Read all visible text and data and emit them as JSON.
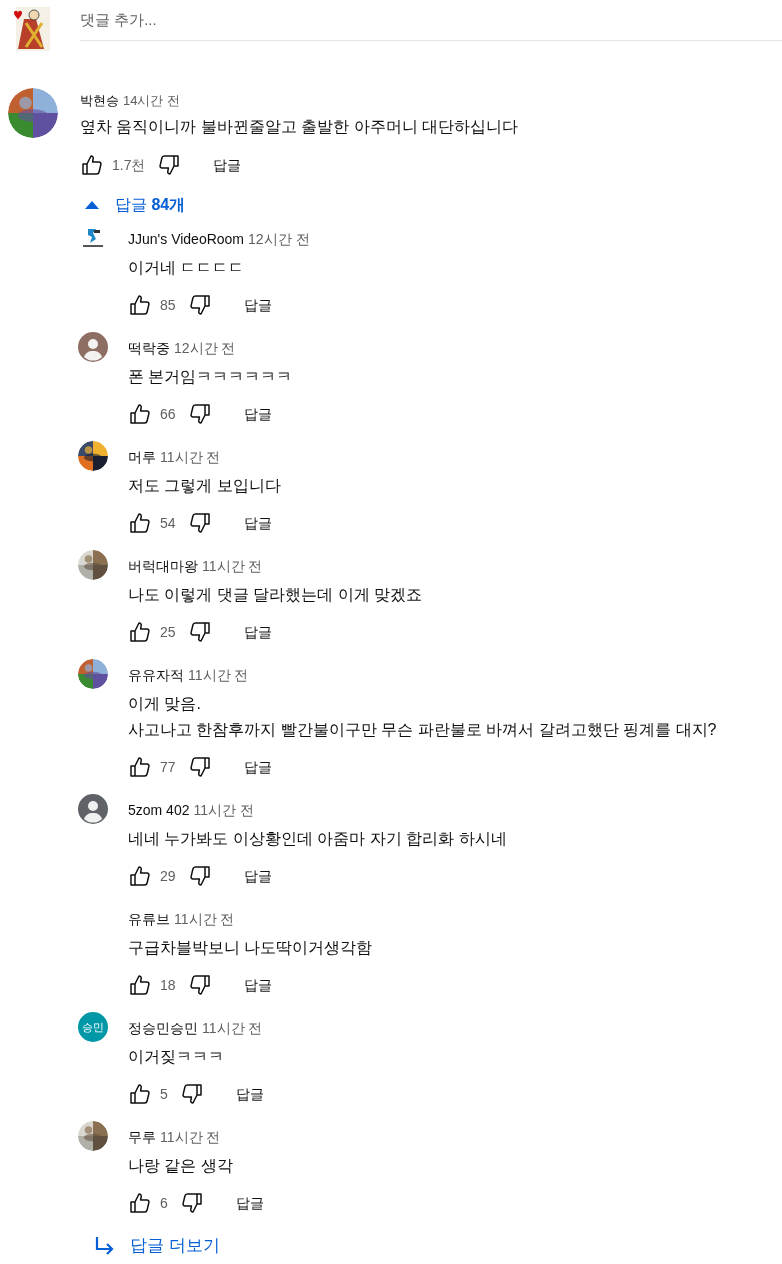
{
  "add_comment": {
    "placeholder": "댓글 추가..."
  },
  "comment": {
    "author": "박현승",
    "time": "14시간 전",
    "text": "옆차 움직이니까 불바뀐줄알고 출발한 아주머니 대단하십니다",
    "likes": "1.7천",
    "reply_label": "답글",
    "replies_toggle": {
      "label": "답글",
      "count": "84개",
      "expanded": true
    }
  },
  "replies": [
    {
      "avatar": {
        "kind": "logo"
      },
      "author": "JJun's VideoRoom",
      "time": "12시간 전",
      "lines": [
        "이거네 ㄷㄷㄷㄷ"
      ],
      "likes": "85",
      "reply_label": "답글"
    },
    {
      "avatar": {
        "kind": "silhouette",
        "color": "#8d6e63"
      },
      "author": "떡락중",
      "time": "12시간 전",
      "lines": [
        "폰 본거임ㅋㅋㅋㅋㅋㅋ"
      ],
      "likes": "66",
      "reply_label": "답글"
    },
    {
      "avatar": {
        "kind": "picture"
      },
      "author": "머루",
      "time": "11시간 전",
      "lines": [
        "저도 그렇게 보입니다"
      ],
      "likes": "54",
      "reply_label": "답글"
    },
    {
      "avatar": {
        "kind": "picture"
      },
      "author": "버럭대마왕",
      "time": "11시간 전",
      "lines": [
        "나도 이렇게 댓글 달라했는데 이게 맞겠죠"
      ],
      "likes": "25",
      "reply_label": "답글"
    },
    {
      "avatar": {
        "kind": "picture"
      },
      "author": "유유자적",
      "time": "11시간 전",
      "lines": [
        "이게 맞음.",
        "사고나고 한참후까지 빨간불이구만 무슨 파란불로 바껴서 갈려고했단 핑계를 대지?"
      ],
      "likes": "77",
      "reply_label": "답글"
    },
    {
      "avatar": {
        "kind": "silhouette",
        "color": "#5f6368"
      },
      "author": "5zom 402",
      "time": "11시간 전",
      "lines": [
        "네네 누가봐도 이상황인데 아줌마 자기 합리화 하시네"
      ],
      "likes": "29",
      "reply_label": "답글"
    },
    {
      "avatar": {
        "kind": "none"
      },
      "author": "유류브",
      "time": "11시간 전",
      "lines": [
        "구급차블박보니 나도딱이거생각함"
      ],
      "likes": "18",
      "reply_label": "답글"
    },
    {
      "avatar": {
        "kind": "initials",
        "text": "승민",
        "color": "#0097a7"
      },
      "author": "정승민승민",
      "time": "11시간 전",
      "lines": [
        "이거짖ㅋㅋㅋ"
      ],
      "likes": "5",
      "reply_label": "답글"
    },
    {
      "avatar": {
        "kind": "picture"
      },
      "author": "무루",
      "time": "11시간 전",
      "lines": [
        "나랑 같은 생각"
      ],
      "likes": "6",
      "reply_label": "답글"
    }
  ],
  "more_replies": {
    "label": "답글 더보기"
  }
}
